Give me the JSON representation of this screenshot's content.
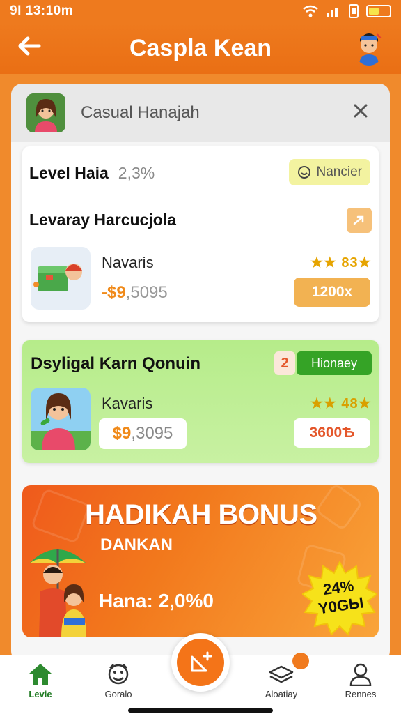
{
  "status_bar": {
    "time": "9I 13:10m"
  },
  "app_bar": {
    "title": "Caspla Kean"
  },
  "dialog": {
    "title": "Casual Hanajah"
  },
  "level_row": {
    "label": "Level Haia",
    "value": "2,3%",
    "pill": "Nancier"
  },
  "section1": {
    "title": "Levaray Harcucjola",
    "item_name": "Navaris",
    "price_symbol": "-$9",
    "price_value": ",5095",
    "rating": "★★ 83★",
    "amount_button": "1200x"
  },
  "section2": {
    "title": "Dsyligal Karn Qonuin",
    "edit_glyph": "2",
    "tag": "Hionaey",
    "item_name": "Kavaris",
    "price_symbol": "$9",
    "price_value": ",3095",
    "rating": "★★ 48★",
    "amount_button": "3600Ѣ"
  },
  "banner": {
    "title": "HADIKAH BONUS",
    "subtitle": "DANKAN",
    "rate": "Hana: 2,0%0",
    "badge_line1": "24%",
    "badge_line2": "Y0GЫ"
  },
  "bottom_nav": {
    "items": [
      {
        "label": "Levie",
        "icon": "home-icon",
        "active": true
      },
      {
        "label": "Goralo",
        "icon": "gamepad-icon",
        "active": false
      },
      {
        "label": "Aloatiay",
        "icon": "layers-icon",
        "active": false
      },
      {
        "label": "Rennes",
        "icon": "person-icon",
        "active": false
      }
    ]
  },
  "colors": {
    "brand_orange": "#ee7a1e",
    "green_tag": "#35a326",
    "amount_orange": "#f2b252"
  }
}
